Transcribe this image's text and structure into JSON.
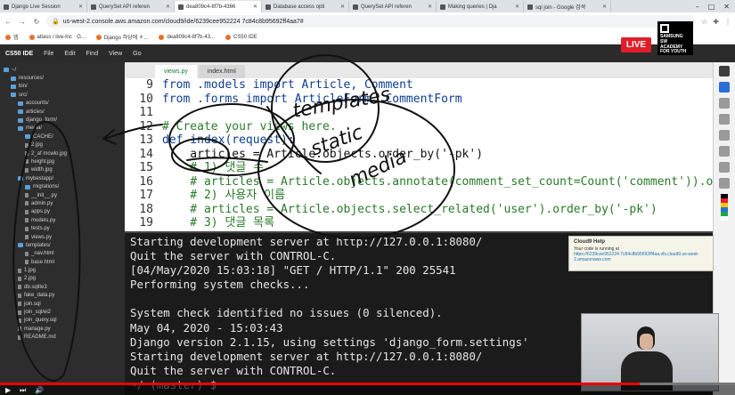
{
  "browser": {
    "tabs": [
      {
        "label": "Django Live Session",
        "active": false
      },
      {
        "label": "QuerySet API referen",
        "active": false
      },
      {
        "label": "dea809c4-8f7b-4366",
        "active": true
      },
      {
        "label": "Database access opti",
        "active": false
      },
      {
        "label": "QuerySet API referen",
        "active": false
      },
      {
        "label": "Making queries | Dja",
        "active": false
      },
      {
        "label": "sql join - Google 검색",
        "active": false
      }
    ],
    "url": "us-west-2.console.aws.amazon.com/cloud9/ide/6239cee952224 7c84c8b95692ff4aa7#",
    "bookmarks": [
      {
        "label": "앱"
      },
      {
        "label": "atlass / live-lnc · G..."
      },
      {
        "label": "Django 하당에 ㅊ..."
      },
      {
        "label": "dea809c4-8f7b-43..."
      },
      {
        "label": "CS50 IDE"
      }
    ]
  },
  "ide": {
    "brand": "CS50 IDE",
    "menu": [
      "File",
      "Edit",
      "Find",
      "View",
      "Go"
    ],
    "editor_tabs": [
      {
        "label": "views.py",
        "active": true
      },
      {
        "label": "index.html",
        "active": false
      }
    ],
    "code_lines": [
      {
        "num": "9",
        "text": "from .models import Article, Comment",
        "style": "kw"
      },
      {
        "num": "10",
        "text": "from .forms import ArticleForm, CommentForm",
        "style": "kw"
      },
      {
        "num": "11",
        "text": "",
        "style": ""
      },
      {
        "num": "12",
        "text": "# Create your views here.",
        "style": "comment"
      },
      {
        "num": "13",
        "text": "def index(request):",
        "style": "kw"
      },
      {
        "num": "14",
        "text": "    articles = Article.objects.order_by('-pk')",
        "style": ""
      },
      {
        "num": "15",
        "text": "    # 1) 댓글 수",
        "style": "comment"
      },
      {
        "num": "16",
        "text": "    # articles = Article.objects.annotate(comment_set_count=Count('comment')).order_by('-pk')",
        "style": "comment"
      },
      {
        "num": "17",
        "text": "    # 2) 사용자 이름",
        "style": "comment"
      },
      {
        "num": "18",
        "text": "    # articles = Article.objects.select_related('user').order_by('-pk')",
        "style": "comment"
      },
      {
        "num": "19",
        "text": "    # 3) 댓글 목록",
        "style": "comment"
      }
    ],
    "file_tree": [
      {
        "label": "~/",
        "indent": 0,
        "type": "folder"
      },
      {
        "label": "resources/",
        "indent": 1,
        "type": "folder"
      },
      {
        "label": "bin/",
        "indent": 1,
        "type": "folder"
      },
      {
        "label": "src/",
        "indent": 1,
        "type": "folder"
      },
      {
        "label": "accounts/",
        "indent": 2,
        "type": "folder"
      },
      {
        "label": "articles/",
        "indent": 2,
        "type": "folder"
      },
      {
        "label": "django_form/",
        "indent": 2,
        "type": "folder"
      },
      {
        "label": "media/",
        "indent": 2,
        "type": "folder"
      },
      {
        "label": "CACHE/",
        "indent": 3,
        "type": "folder"
      },
      {
        "label": "2.jpg",
        "indent": 3,
        "type": "file"
      },
      {
        "label": "2_af mcwlo.jpg",
        "indent": 3,
        "type": "file"
      },
      {
        "label": "height.jpg",
        "indent": 3,
        "type": "file"
      },
      {
        "label": "width.jpg",
        "indent": 3,
        "type": "file"
      },
      {
        "label": "mybestapp/",
        "indent": 2,
        "type": "folder"
      },
      {
        "label": "migrations/",
        "indent": 3,
        "type": "folder"
      },
      {
        "label": "__init__.py",
        "indent": 3,
        "type": "file"
      },
      {
        "label": "admin.py",
        "indent": 3,
        "type": "file"
      },
      {
        "label": "apps.py",
        "indent": 3,
        "type": "file"
      },
      {
        "label": "models.py",
        "indent": 3,
        "type": "file"
      },
      {
        "label": "tests.py",
        "indent": 3,
        "type": "file"
      },
      {
        "label": "views.py",
        "indent": 3,
        "type": "file"
      },
      {
        "label": "templates/",
        "indent": 2,
        "type": "folder"
      },
      {
        "label": "_nav.html",
        "indent": 3,
        "type": "file"
      },
      {
        "label": "base.html",
        "indent": 3,
        "type": "file"
      },
      {
        "label": "1.jpg",
        "indent": 2,
        "type": "file"
      },
      {
        "label": "2.jpg",
        "indent": 2,
        "type": "file"
      },
      {
        "label": "db.sqlite3",
        "indent": 2,
        "type": "file"
      },
      {
        "label": "fake_data.py",
        "indent": 2,
        "type": "file"
      },
      {
        "label": "join.sql",
        "indent": 2,
        "type": "file"
      },
      {
        "label": "join_sql/ei2",
        "indent": 2,
        "type": "file"
      },
      {
        "label": "join_query.sql",
        "indent": 2,
        "type": "file"
      },
      {
        "label": "manage.py",
        "indent": 2,
        "type": "file"
      },
      {
        "label": "README.md",
        "indent": 2,
        "type": "file"
      }
    ],
    "terminal_lines": [
      "Starting development server at http://127.0.0.1:8080/",
      "Quit the server with CONTROL-C.",
      "[04/May/2020 15:03:18] \"GET / HTTP/1.1\" 200 25541",
      "Performing system checks...",
      "",
      "System check identified no issues (0 silenced).",
      "May 04, 2020 - 15:03:43",
      "Django version 2.1.15, using settings 'django_form.settings'",
      "Starting development server at http://127.0.0.1:8080/",
      "Quit the server with CONTROL-C."
    ],
    "terminal_prompt": "~/ (master) $",
    "help_popup": {
      "title": "Cloud9 Help",
      "body": "Your code is running at",
      "link": "https://6239cee952224 7c84c8b95692ff4aa.vfs.cloud9.us-west-2.amazonaws.com"
    }
  },
  "overlay": {
    "live_label": "LIVE",
    "academy_text": "SAMSUNG SW ACADEMY FOR YOUTH",
    "handwriting": [
      "templates",
      "static",
      "media"
    ]
  },
  "video": {
    "progress": 0.87
  }
}
